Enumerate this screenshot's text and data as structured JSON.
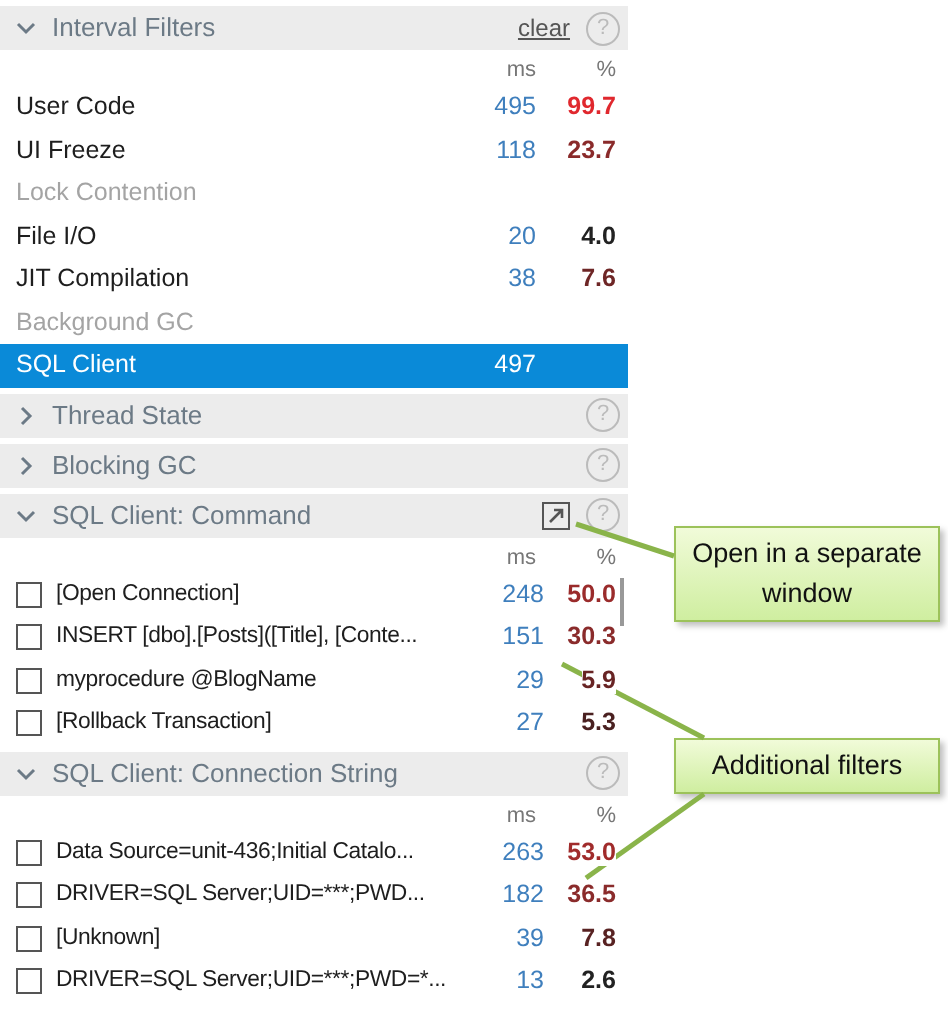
{
  "sections": [
    {
      "kind": "filters",
      "title": "Interval Filters",
      "expanded": true,
      "clear_link": "clear",
      "help": "?",
      "columns": [
        "ms",
        "%"
      ],
      "rows": [
        {
          "label": "User Code",
          "ms": "495",
          "pct": "99.7",
          "color": "#e0282e",
          "disabled": false,
          "selected": false
        },
        {
          "label": "UI Freeze",
          "ms": "118",
          "pct": "23.7",
          "color": "#8a2a2a",
          "disabled": false,
          "selected": false
        },
        {
          "label": "Lock Contention",
          "disabled": true,
          "selected": false
        },
        {
          "label": "File I/O",
          "ms": "20",
          "pct": "4.0",
          "color": "#222222",
          "disabled": false,
          "selected": false
        },
        {
          "label": "JIT Compilation",
          "ms": "38",
          "pct": "7.6",
          "color": "#6e2626",
          "disabled": false,
          "selected": false
        },
        {
          "label": "Background GC",
          "disabled": true,
          "selected": false
        },
        {
          "label": "SQL Client",
          "ms": "497",
          "disabled": false,
          "selected": true
        }
      ]
    },
    {
      "kind": "collapsed",
      "title": "Thread State",
      "expanded": false,
      "help": "?"
    },
    {
      "kind": "collapsed",
      "title": "Blocking GC",
      "expanded": false,
      "help": "?"
    },
    {
      "kind": "checklist",
      "title": "SQL Client: Command",
      "expanded": true,
      "popout": true,
      "help": "?",
      "columns": [
        "ms",
        "%"
      ],
      "scrollbar": true,
      "rows": [
        {
          "label": "[Open Connection]",
          "checked": false,
          "ms": "248",
          "pct": "50.0",
          "color": "#9a2b2b"
        },
        {
          "label": "INSERT [dbo].[Posts]([Title], [Conte...",
          "checked": false,
          "ms": "151",
          "pct": "30.3",
          "color": "#8a2b2b"
        },
        {
          "label": "myprocedure @BlogName",
          "checked": false,
          "ms": "29",
          "pct": "5.9",
          "color": "#682424"
        },
        {
          "label": "[Rollback Transaction]",
          "checked": false,
          "ms": "27",
          "pct": "5.3",
          "color": "#4a2020"
        }
      ]
    },
    {
      "kind": "checklist",
      "title": "SQL Client: Connection String",
      "expanded": true,
      "help": "?",
      "columns": [
        "ms",
        "%"
      ],
      "rows": [
        {
          "label": "Data Source=unit-436;Initial Catalo...",
          "checked": false,
          "ms": "263",
          "pct": "53.0",
          "color": "#a02b2b"
        },
        {
          "label": "DRIVER=SQL Server;UID=***;PWD...",
          "checked": false,
          "ms": "182",
          "pct": "36.5",
          "color": "#8a2b2b"
        },
        {
          "label": "[Unknown]",
          "checked": false,
          "ms": "39",
          "pct": "7.8",
          "color": "#582222"
        },
        {
          "label": "DRIVER=SQL Server;UID=***;PWD=*...",
          "checked": false,
          "ms": "13",
          "pct": "2.6",
          "color": "#222222"
        }
      ]
    }
  ],
  "callouts": [
    {
      "text": "Open in a separate window"
    },
    {
      "text": "Additional filters"
    }
  ]
}
